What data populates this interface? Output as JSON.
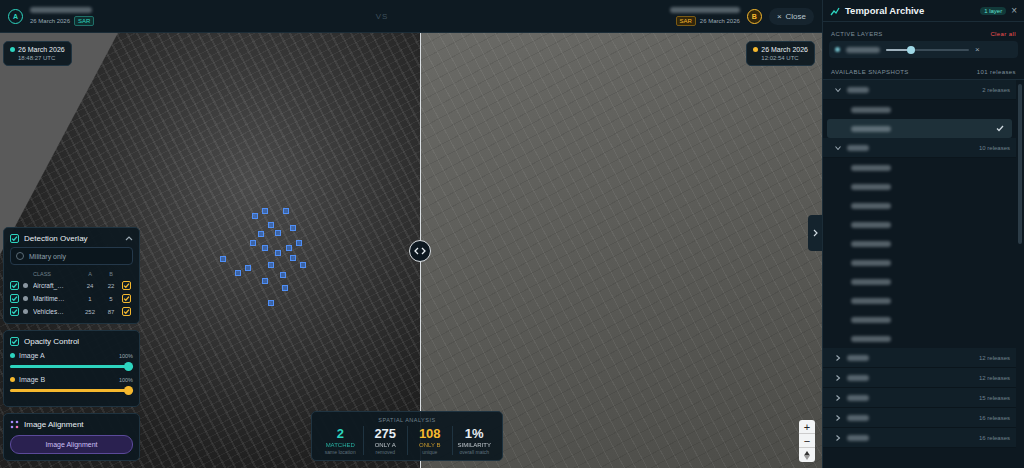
{
  "header": {
    "a": {
      "badge": "A",
      "date": "26 March 2026",
      "sensor": "SAR"
    },
    "vs": "VS",
    "b": {
      "badge": "B",
      "date": "26 March 2026",
      "sensor": "SAR"
    },
    "close": {
      "icon": "×",
      "label": "Close"
    }
  },
  "timestamps": [
    {
      "date": "26 March 2026",
      "time": "18:48:27 UTC",
      "color": "#2dd4bf"
    },
    {
      "date": "26 March 2026",
      "time": "12:02:54 UTC",
      "color": "#f5b82e"
    }
  ],
  "detection": {
    "title": "Detection Overlay",
    "enabled": true,
    "expanded": true,
    "military_only": {
      "label": "Military only",
      "on": false
    },
    "columns": [
      "CLASS",
      "A",
      "B"
    ],
    "rows": [
      {
        "label": "Aircraft_…",
        "a": "24",
        "b": "22",
        "checked": true,
        "b_checked": true
      },
      {
        "label": "Maritime…",
        "a": "1",
        "b": "5",
        "checked": true,
        "b_checked": true
      },
      {
        "label": "Vehicles…",
        "a": "252",
        "b": "87",
        "checked": true,
        "b_checked": true
      }
    ]
  },
  "opacity": {
    "title": "Opacity Control",
    "enabled": true,
    "images": [
      {
        "label": "Image A",
        "reading": "100%",
        "level": 1,
        "color": "#2dd4bf"
      },
      {
        "label": "Image B",
        "reading": "100%",
        "level": 1,
        "color": "#f5b82e"
      }
    ]
  },
  "alignment": {
    "title": "Image Alignment",
    "button": "Image Alignment"
  },
  "analysis": {
    "title": "SPATIAL ANALYSIS",
    "stats": [
      {
        "value": "2",
        "label": "MATCHED",
        "sub": "same location",
        "color": "#2dd4bf"
      },
      {
        "value": "275",
        "label": "ONLY A",
        "sub": "removed",
        "color": "#e6edf2"
      },
      {
        "value": "108",
        "label": "ONLY B",
        "sub": "unique",
        "color": "#f5b82e"
      },
      {
        "value": "1%",
        "label": "SIMILARITY",
        "sub": "overall match",
        "color": "#e6edf2"
      }
    ]
  },
  "zoom": {
    "in": "+",
    "out": "−"
  },
  "archive": {
    "title": "Temporal Archive",
    "badge": "1 layer",
    "close": "×",
    "active_title": "ACTIVE LAYERS",
    "clear": "Clear all",
    "layers": [
      {
        "level": 0.3,
        "remove": "×"
      }
    ],
    "available_title": "AVAILABLE SNAPSHOTS",
    "total": "101 releases",
    "groups": [
      {
        "count": "2 releases",
        "expanded": true,
        "items": [
          {
            "selected": false
          },
          {
            "selected": true
          }
        ]
      },
      {
        "count": "10 releases",
        "expanded": true,
        "items": [
          {
            "selected": false
          },
          {
            "selected": false
          },
          {
            "selected": false
          },
          {
            "selected": false
          },
          {
            "selected": false
          },
          {
            "selected": false
          },
          {
            "selected": false
          },
          {
            "selected": false
          },
          {
            "selected": false
          },
          {
            "selected": false
          }
        ]
      },
      {
        "count": "12 releases",
        "expanded": false,
        "items": []
      },
      {
        "count": "12 releases",
        "expanded": false,
        "items": []
      },
      {
        "count": "15 releases",
        "expanded": false,
        "items": []
      },
      {
        "count": "16 releases",
        "expanded": false,
        "items": []
      },
      {
        "count": "16 releases",
        "expanded": false,
        "items": []
      }
    ]
  }
}
